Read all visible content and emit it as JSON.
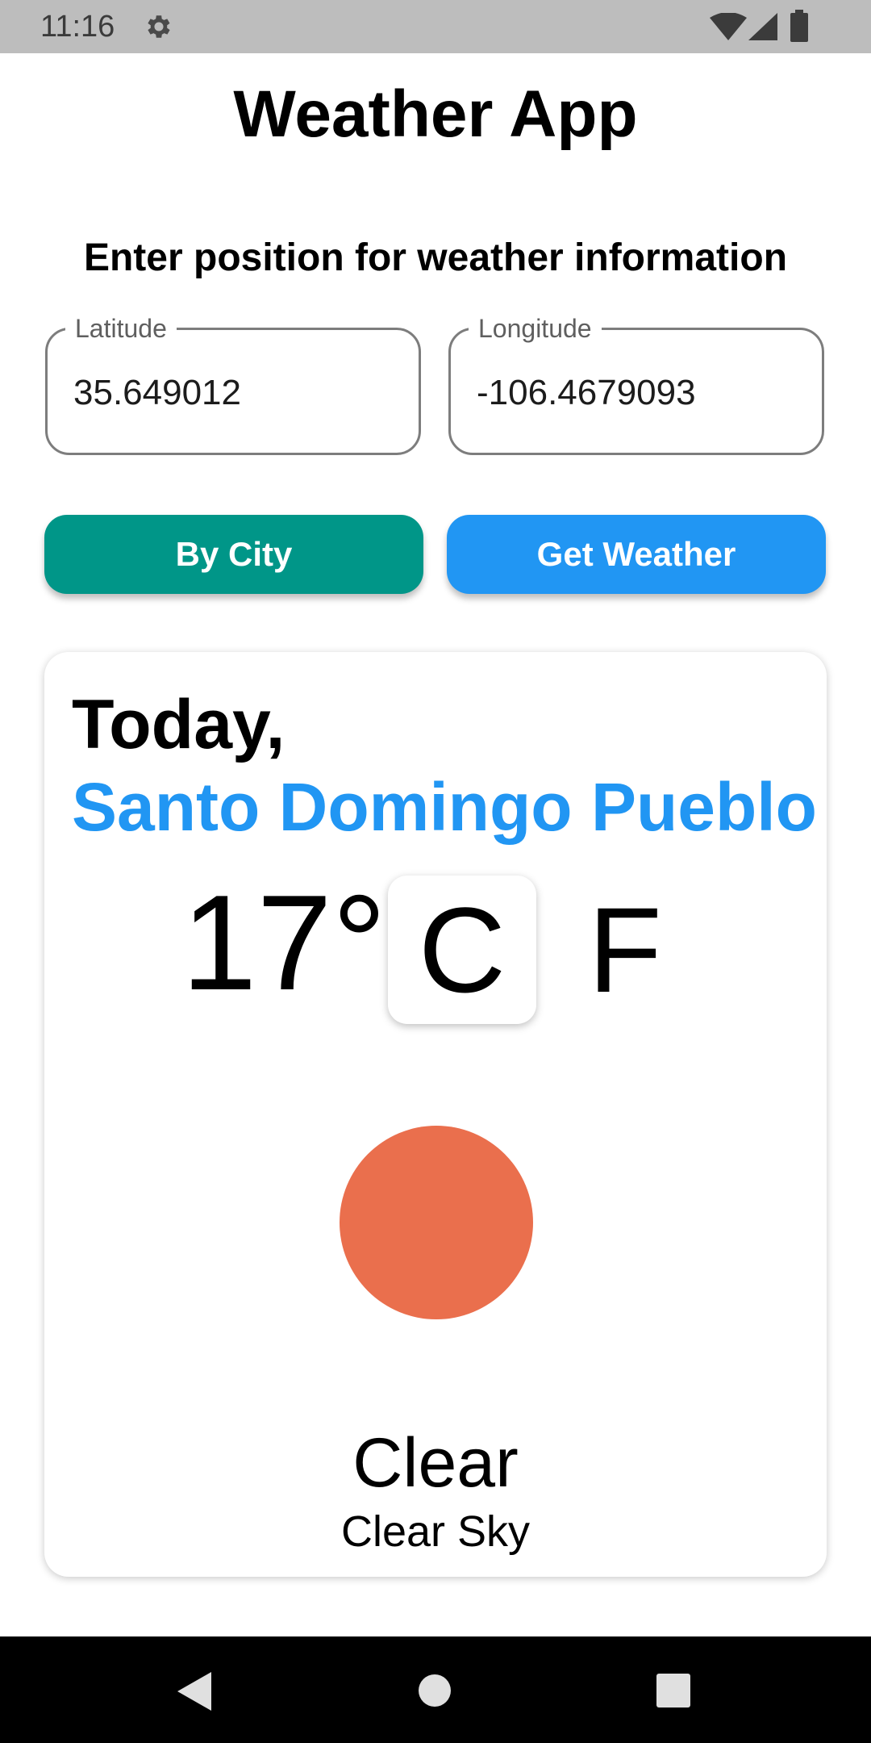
{
  "status_bar": {
    "time": "11:16",
    "icons": [
      "gear-icon",
      "wifi-icon",
      "signal-icon",
      "battery-icon"
    ]
  },
  "header": {
    "title": "Weather App",
    "subtitle": "Enter position for weather information"
  },
  "form": {
    "latitude": {
      "label": "Latitude",
      "value": "35.649012"
    },
    "longitude": {
      "label": "Longitude",
      "value": "-106.4679093"
    }
  },
  "buttons": {
    "by_city": "By City",
    "get_weather": "Get Weather"
  },
  "weather": {
    "day": "Today,",
    "city": "Santo Domingo Pueblo",
    "temperature": "17°",
    "units": {
      "celsius": "C",
      "fahrenheit": "F",
      "selected": "C"
    },
    "icon": "sun-icon",
    "condition": "Clear",
    "description": "Clear Sky"
  },
  "nav": {
    "icons": [
      "back-icon",
      "home-icon",
      "recents-icon"
    ]
  },
  "colors": {
    "accent_blue": "#2196f3",
    "accent_teal": "#009688",
    "sun": "#ea6f4d",
    "status_bar": "#bdbdbd"
  }
}
